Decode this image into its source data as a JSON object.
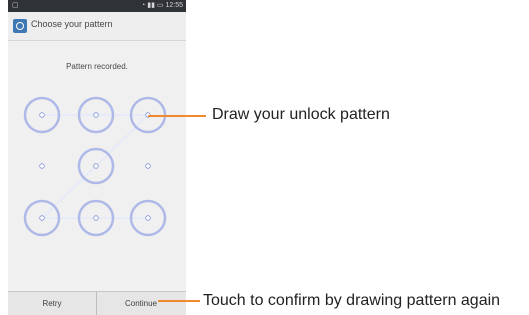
{
  "status_bar": {
    "time": "12:55",
    "left_icon": "notification-icon",
    "right_icons": [
      "wifi-icon",
      "signal-icon",
      "battery-icon"
    ]
  },
  "header": {
    "title": "Choose your pattern",
    "icon": "settings-icon"
  },
  "message": "Pattern recorded.",
  "pattern": {
    "dots": [
      {
        "row": 1,
        "col": 1,
        "selected": true
      },
      {
        "row": 1,
        "col": 2,
        "selected": true
      },
      {
        "row": 1,
        "col": 3,
        "selected": true
      },
      {
        "row": 2,
        "col": 1,
        "selected": false
      },
      {
        "row": 2,
        "col": 2,
        "selected": true
      },
      {
        "row": 2,
        "col": 3,
        "selected": false
      },
      {
        "row": 3,
        "col": 1,
        "selected": true
      },
      {
        "row": 3,
        "col": 2,
        "selected": true
      },
      {
        "row": 3,
        "col": 3,
        "selected": true
      }
    ],
    "path": [
      1,
      2,
      3,
      5,
      7,
      8,
      9
    ]
  },
  "buttons": {
    "retry": "Retry",
    "continue": "Continue"
  },
  "callouts": {
    "draw": "Draw your unlock pattern",
    "confirm": "Touch to confirm by drawing pattern again"
  }
}
